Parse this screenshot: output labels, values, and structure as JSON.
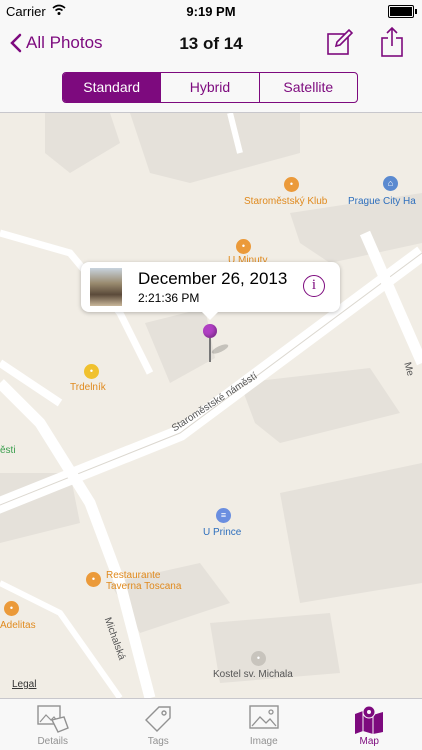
{
  "status_bar": {
    "carrier": "Carrier",
    "time": "9:19 PM"
  },
  "nav": {
    "back_label": "All Photos",
    "title": "13 of 14"
  },
  "segments": [
    {
      "label": "Standard",
      "active": true
    },
    {
      "label": "Hybrid",
      "active": false
    },
    {
      "label": "Satellite",
      "active": false
    }
  ],
  "map": {
    "pois": {
      "staromestsky_klub": "Staroměstský Klub",
      "prague_city": "Prague City Ha",
      "u_minuty": "U Minuty",
      "trdelnik": "Trdelník",
      "u_prince": "U Prince",
      "restaurante_1": "Restaurante",
      "restaurante_2": "Taverna Toscana",
      "adelitas": "Adelitas",
      "kostel": "Kostel sv. Michala",
      "mesti_left": "ěsti",
      "me_right": "Me"
    },
    "streets": {
      "staromestske": "Staroměstské náměstí",
      "michalska": "Michalská"
    },
    "legal": "Legal"
  },
  "callout": {
    "date": "December 26, 2013",
    "time": "2:21:36 PM",
    "info_glyph": "i"
  },
  "tabs": [
    {
      "label": "Details",
      "icon": "details-photo-tag-icon",
      "active": false
    },
    {
      "label": "Tags",
      "icon": "tag-icon",
      "active": false
    },
    {
      "label": "Image",
      "icon": "image-icon",
      "active": false
    },
    {
      "label": "Map",
      "icon": "map-icon",
      "active": true
    }
  ],
  "colors": {
    "accent": "#7d0a7e",
    "pin": "#b03fc3",
    "poi_orange": "#e08a1e",
    "poi_blue": "#2e6fbd"
  }
}
